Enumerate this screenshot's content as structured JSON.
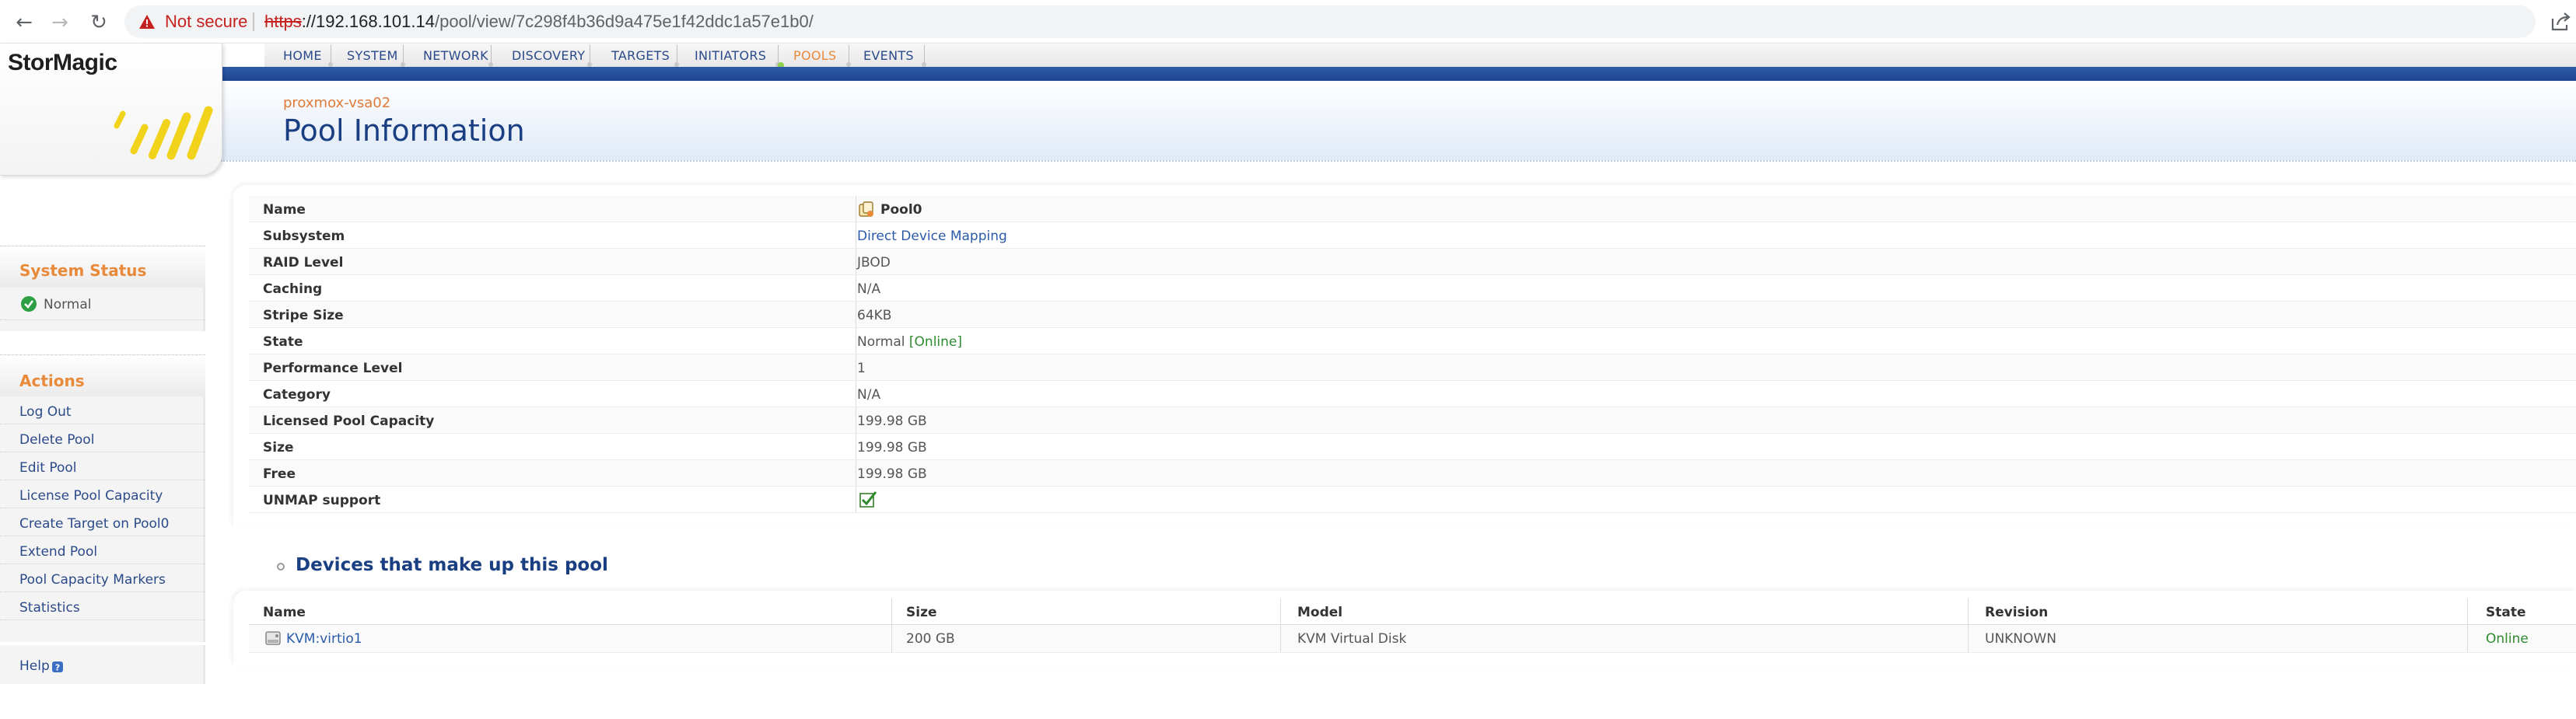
{
  "browser": {
    "security_label": "Not secure",
    "url_scheme": "https",
    "url_host": "://192.168.101.14",
    "url_path": "/pool/view/7c298f4b36d9a475e1f42ddc1a57e1b0/"
  },
  "app": {
    "logo": "StorMagic",
    "accent_color": "#e98a3a",
    "brand_blue": "#1a3e82"
  },
  "nav": {
    "items": [
      "HOME",
      "SYSTEM",
      "NETWORK",
      "DISCOVERY",
      "TARGETS",
      "INITIATORS",
      "POOLS",
      "EVENTS"
    ],
    "active": "POOLS"
  },
  "header": {
    "host": "proxmox-vsa02",
    "title": "Pool Information"
  },
  "sidebar": {
    "status_heading": "System Status",
    "status_value": "Normal",
    "actions_heading": "Actions",
    "actions": [
      "Log Out",
      "Delete Pool",
      "Edit Pool",
      "License Pool Capacity",
      "Create Target on Pool0",
      "Extend Pool",
      "Pool Capacity Markers",
      "Statistics"
    ],
    "help": "Help"
  },
  "pool": {
    "rows": [
      {
        "label": "Name",
        "value": "Pool0"
      },
      {
        "label": "Subsystem",
        "value": "Direct Device Mapping"
      },
      {
        "label": "RAID Level",
        "value": "JBOD"
      },
      {
        "label": "Caching",
        "value": "N/A"
      },
      {
        "label": "Stripe Size",
        "value": "64KB"
      },
      {
        "label": "State",
        "value": "Normal",
        "extra": "[Online]"
      },
      {
        "label": "Performance Level",
        "value": "1"
      },
      {
        "label": "Category",
        "value": "N/A"
      },
      {
        "label": "Licensed Pool Capacity",
        "value": "199.98 GB"
      },
      {
        "label": "Size",
        "value": "199.98 GB"
      },
      {
        "label": "Free",
        "value": "199.98 GB"
      },
      {
        "label": "UNMAP support",
        "value_icon": "checkbox-checked-icon"
      }
    ]
  },
  "devices": {
    "title": "Devices that make up this pool",
    "headers": [
      "Name",
      "Size",
      "Model",
      "Revision",
      "State"
    ],
    "rows": [
      {
        "name": "KVM:virtio1",
        "size": "200 GB",
        "model": "KVM Virtual Disk",
        "revision": "UNKNOWN",
        "state": "Online"
      }
    ]
  }
}
